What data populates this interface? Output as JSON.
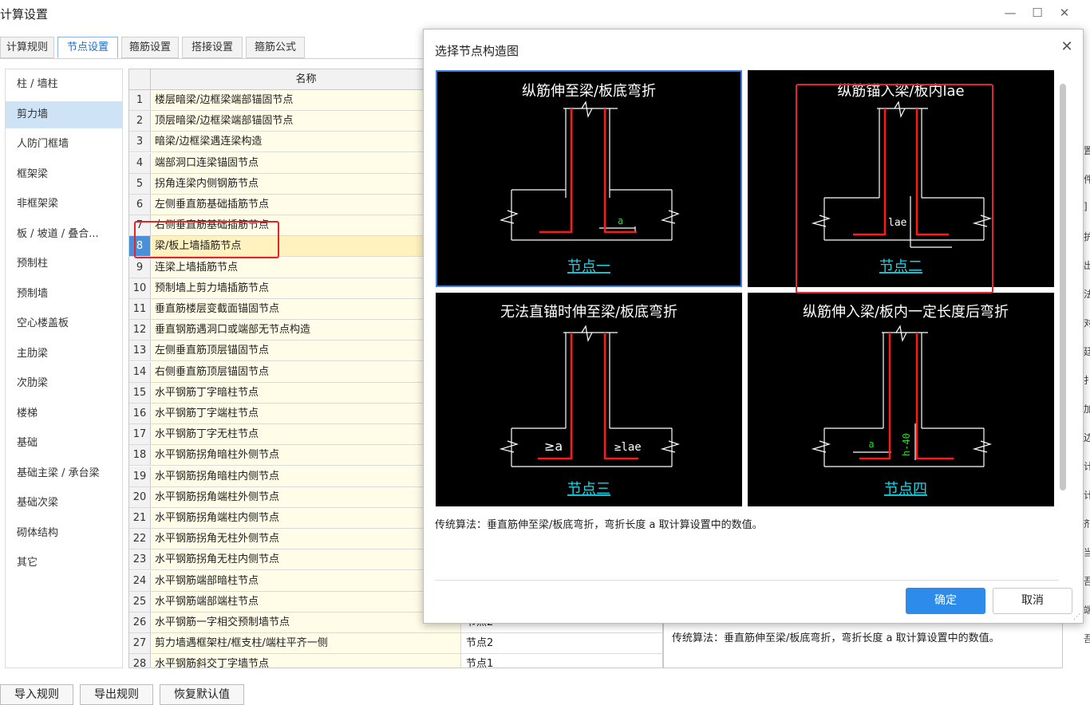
{
  "window": {
    "title": "计算设置",
    "minimize": "—",
    "maximize": "☐",
    "close": "✕"
  },
  "tabs": [
    "计算规则",
    "节点设置",
    "箍筋设置",
    "搭接设置",
    "箍筋公式"
  ],
  "active_tab": "节点设置",
  "sidebar": {
    "items": [
      "柱 / 墙柱",
      "剪力墙",
      "人防门框墙",
      "框架梁",
      "非框架梁",
      "板 / 坡道 / 叠合...",
      "预制柱",
      "预制墙",
      "空心楼盖板",
      "主肋梁",
      "次肋梁",
      "楼梯",
      "基础",
      "基础主梁 / 承台梁",
      "基础次梁",
      "砌体结构",
      "其它"
    ],
    "selected": "剪力墙"
  },
  "grid": {
    "header_name": "名称",
    "rows": [
      {
        "num": "1",
        "name": "楼层暗梁/边框梁端部锚固节点",
        "value": ""
      },
      {
        "num": "2",
        "name": "顶层暗梁/边框梁端部锚固节点",
        "value": ""
      },
      {
        "num": "3",
        "name": "暗梁/边框梁遇连梁构造",
        "value": ""
      },
      {
        "num": "4",
        "name": "端部洞口连梁锚固节点",
        "value": ""
      },
      {
        "num": "5",
        "name": "拐角连梁内侧钢筋节点",
        "value": ""
      },
      {
        "num": "6",
        "name": "左侧垂直筋基础插筋节点",
        "value": ""
      },
      {
        "num": "7",
        "name": "右侧垂直筋基础插筋节点",
        "value": ""
      },
      {
        "num": "8",
        "name": "梁/板上墙插筋节点",
        "value": ""
      },
      {
        "num": "9",
        "name": "连梁上墙插筋节点",
        "value": ""
      },
      {
        "num": "10",
        "name": "预制墙上剪力墙插筋节点",
        "value": ""
      },
      {
        "num": "11",
        "name": "垂直筋楼层变截面锚固节点",
        "value": ""
      },
      {
        "num": "12",
        "name": "垂直钢筋遇洞口或端部无节点构造",
        "value": ""
      },
      {
        "num": "13",
        "name": "左侧垂直筋顶层锚固节点",
        "value": ""
      },
      {
        "num": "14",
        "name": "右侧垂直筋顶层锚固节点",
        "value": ""
      },
      {
        "num": "15",
        "name": "水平钢筋丁字暗柱节点",
        "value": ""
      },
      {
        "num": "16",
        "name": "水平钢筋丁字端柱节点",
        "value": ""
      },
      {
        "num": "17",
        "name": "水平钢筋丁字无柱节点",
        "value": ""
      },
      {
        "num": "18",
        "name": "水平钢筋拐角暗柱外侧节点",
        "value": ""
      },
      {
        "num": "19",
        "name": "水平钢筋拐角暗柱内侧节点",
        "value": ""
      },
      {
        "num": "20",
        "name": "水平钢筋拐角端柱外侧节点",
        "value": ""
      },
      {
        "num": "21",
        "name": "水平钢筋拐角端柱内侧节点",
        "value": ""
      },
      {
        "num": "22",
        "name": "水平钢筋拐角无柱外侧节点",
        "value": ""
      },
      {
        "num": "23",
        "name": "水平钢筋拐角无柱内侧节点",
        "value": ""
      },
      {
        "num": "24",
        "name": "水平钢筋端部暗柱节点",
        "value": ""
      },
      {
        "num": "25",
        "name": "水平钢筋端部端柱节点",
        "value": ""
      },
      {
        "num": "26",
        "name": "水平钢筋一字相交预制墙节点",
        "value": "节点2"
      },
      {
        "num": "27",
        "name": "剪力墙遇框架柱/框支柱/端柱平齐一侧",
        "value": "节点2"
      },
      {
        "num": "28",
        "name": "水平钢筋斜交丁字墙节点",
        "value": "节点1"
      }
    ],
    "selected_num": "8"
  },
  "description": "传统算法：垂直筋伸至梁/板底弯折，弯折长度 a 取计算设置中的数值。",
  "bottom_buttons": [
    "导入规则",
    "导出规则",
    "恢复默认值"
  ],
  "right_clip_chars": [
    "置",
    "件",
    "]",
    "护",
    "出",
    "法",
    "对",
    "廷",
    "扌",
    "加",
    "边",
    "计",
    "计",
    "剂",
    "当",
    "吾",
    "端",
    "吾"
  ],
  "dialog": {
    "title": "选择节点构造图",
    "close": "✕",
    "nodes": [
      {
        "title": "纵筋伸至梁/板底弯折",
        "link": "节点一",
        "label1": "a",
        "label2": ""
      },
      {
        "title": "纵筋锚入梁/板内lae",
        "link": "节点二",
        "label1": "lae",
        "label2": ""
      },
      {
        "title": "无法直锚时伸至梁/板底弯折",
        "link": "节点三",
        "label1": "≥a",
        "label2": "≥lae"
      },
      {
        "title": "纵筋伸入梁/板内一定长度后弯折",
        "link": "节点四",
        "label1": "a",
        "label2": "h-40"
      }
    ],
    "selected_node": "节点一",
    "description": "传统算法：垂直筋伸至梁/板底弯折，弯折长度 a 取计算设置中的数值。",
    "ok": "确定",
    "cancel": "取消"
  },
  "colors": {
    "accent": "#2d8ceb",
    "highlight": "#e5232a",
    "rebar": "#ff1a1a",
    "link": "#19d3e6",
    "label_green": "#22dd22"
  }
}
